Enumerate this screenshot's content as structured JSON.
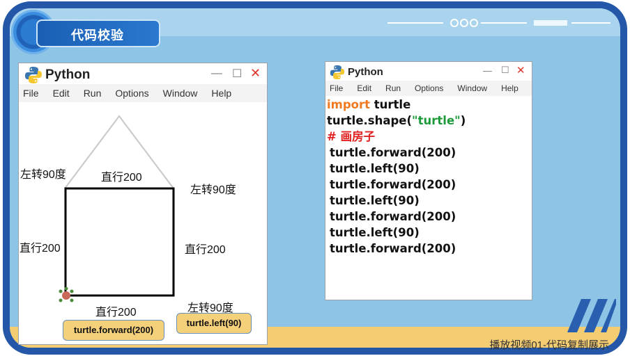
{
  "badge": {
    "title": "代码校验"
  },
  "left_window": {
    "title": "Python",
    "menu": [
      "File",
      "Edit",
      "Run",
      "Options",
      "Window",
      "Help"
    ],
    "controls": {
      "minimize": "—",
      "maximize": "☐",
      "close": "✕"
    }
  },
  "drawing": {
    "labels": {
      "left_turn_top_left": "左转90度",
      "top_forward": "直行200",
      "left_turn_top_right": "左转90度",
      "left_forward": "直行200",
      "right_forward": "直行200",
      "bottom_forward": "直行200",
      "left_turn_bottom_right": "左转90度"
    },
    "chips": {
      "forward": "turtle.forward(200)",
      "left": "turtle.left(90)"
    }
  },
  "right_window": {
    "title": "Python",
    "menu": [
      "File",
      "Edit",
      "Run",
      "Options",
      "Window",
      "Help"
    ],
    "controls": {
      "minimize": "—",
      "maximize": "☐",
      "close": "✕"
    },
    "code": {
      "line1_kw": "import",
      "line1_rest": " turtle",
      "line2_pre": "turtle.shape(",
      "line2_str": "\"turtle\"",
      "line2_post": ")",
      "line3_comment": "# 画房子",
      "line4": "turtle.forward(200)",
      "line5": "turtle.left(90)",
      "line6": "turtle.forward(200)",
      "line7": "turtle.left(90)",
      "line8": "turtle.forward(200)",
      "line9": "turtle.left(90)",
      "line10": "turtle.forward(200)"
    }
  },
  "footer": {
    "caption": "播放视频01-代码复制展示"
  },
  "colors": {
    "frame": "#2457a8",
    "background": "#8ec5e6",
    "keyword": "#f07a1f",
    "string": "#1e9a3a",
    "comment": "#e02222",
    "chip": "#f5d07a"
  }
}
